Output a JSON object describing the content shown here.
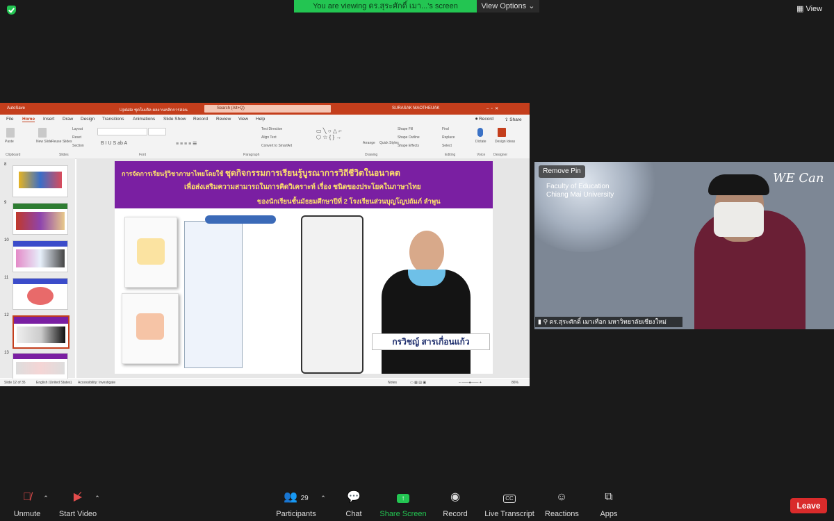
{
  "top": {
    "viewing_text": "You are viewing ดร.สุระศักดิ์ เมา...'s screen",
    "view_options": "View Options",
    "view_button": "View"
  },
  "ppt": {
    "autosave": "AutoSave",
    "doc_title": "Update ชุดโมเดิล ผลงานหลักการสอน",
    "search_placeholder": "Search (Alt+Q)",
    "user": "SURASAK MAOTHEUAK",
    "tabs": [
      "File",
      "Home",
      "Insert",
      "Draw",
      "Design",
      "Transitions",
      "Animations",
      "Slide Show",
      "Record",
      "Review",
      "View",
      "Help"
    ],
    "record_btn": "Record",
    "share_btn": "Share",
    "ribbon_groups": [
      "Clipboard",
      "Slides",
      "Font",
      "Paragraph",
      "Drawing",
      "Editing",
      "Voice",
      "Designer"
    ],
    "ribbon_labels": {
      "paste": "Paste",
      "new_slide": "New Slide",
      "reuse": "Reuse Slides",
      "layout": "Layout",
      "reset": "Reset",
      "section": "Section",
      "text_direction": "Text Direction",
      "align_text": "Align Text",
      "convert_smartart": "Convert to SmartArt",
      "arrange": "Arrange",
      "quick_styles": "Quick Styles",
      "shape_fill": "Shape Fill",
      "shape_outline": "Shape Outline",
      "shape_effects": "Shape Effects",
      "find": "Find",
      "replace": "Replace",
      "select": "Select",
      "dictate": "Dictate",
      "design_ideas": "Design Ideas"
    },
    "thumb_numbers": [
      "8",
      "9",
      "10",
      "11",
      "12",
      "13"
    ],
    "slide": {
      "line1_a": "การจัดการเรียนรู้วิชาภาษาไทยโดยใช้ ",
      "line1_b": "ชุดกิจกรรมการเรียนรู้บูรณาการวิถีชีวิตในอนาคต",
      "line2": "เพื่อส่งเสริมความสามารถในการคิดวิเคราะห์ เรื่อง ชนิดของประโยคในภาษาไทย",
      "line3": "ของนักเรียนชั้นมัธยมศึกษาปีที่ 2 โรงเรียนส่วนบุญโญปถัมภ์ ลำพูน",
      "name_label": "กรวิชญ์ สารเกื่อนแก้ว"
    },
    "status": {
      "slide_of": "Slide 12 of 35",
      "language": "English (United States)",
      "accessibility": "Accessibility: Investigate",
      "notes": "Notes",
      "zoom": "86%"
    }
  },
  "video": {
    "remove_pin": "Remove Pin",
    "faculty_line1": "Faculty of Education",
    "faculty_line2": "Chiang Mai University",
    "brand": "WE Can",
    "participant_name": "ดร.สุระศักดิ์ เมาเทือก มหาวิทยาลัยเชียงใหม่"
  },
  "toolbar": {
    "unmute": "Unmute",
    "start_video": "Start Video",
    "participants": "Participants",
    "participants_count": "29",
    "chat": "Chat",
    "share_screen": "Share Screen",
    "record": "Record",
    "live_transcript": "Live Transcript",
    "reactions": "Reactions",
    "apps": "Apps",
    "leave": "Leave"
  },
  "colors": {
    "zoom_green": "#23c552",
    "ppt_red": "#c43e1c",
    "slide_purple": "#7a1fa2",
    "leave_red": "#d92b2b"
  }
}
